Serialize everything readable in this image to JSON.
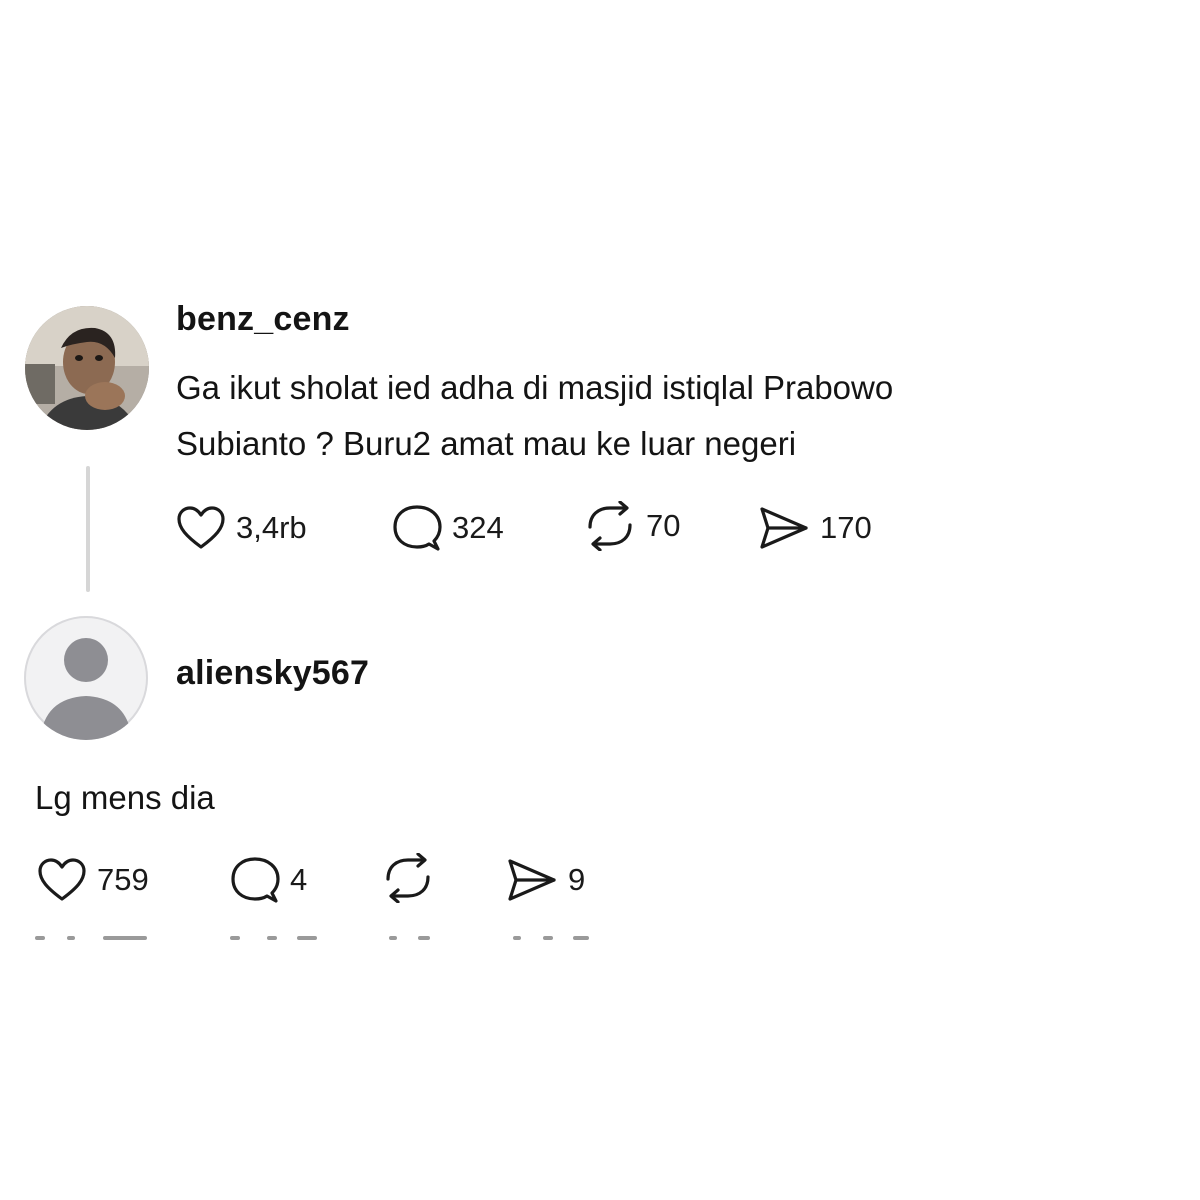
{
  "posts": [
    {
      "username": "benz_cenz",
      "avatar": "user-photo-avatar",
      "text_lines": [
        "Ga ikut sholat ied adha di masjid istiqlal Prabowo",
        "Subianto ? Buru2 amat mau ke luar negeri"
      ],
      "actions": {
        "likes": "3,4rb",
        "replies": "324",
        "reposts": "70",
        "shares": "170"
      }
    },
    {
      "username": "aliensky567",
      "avatar": "default-avatar",
      "text_lines": [
        "Lg mens dia"
      ],
      "actions": {
        "likes": "759",
        "replies": "4",
        "reposts": "",
        "shares": "9"
      }
    }
  ],
  "icons": {
    "like": "heart-icon",
    "reply": "comment-bubble-icon",
    "repost": "repost-icon",
    "share": "send-icon"
  },
  "colors": {
    "text": "#141414",
    "thread_line": "#d6d6d6",
    "default_avatar_bg": "#f2f2f3",
    "default_avatar_fg": "#8e8e93"
  }
}
